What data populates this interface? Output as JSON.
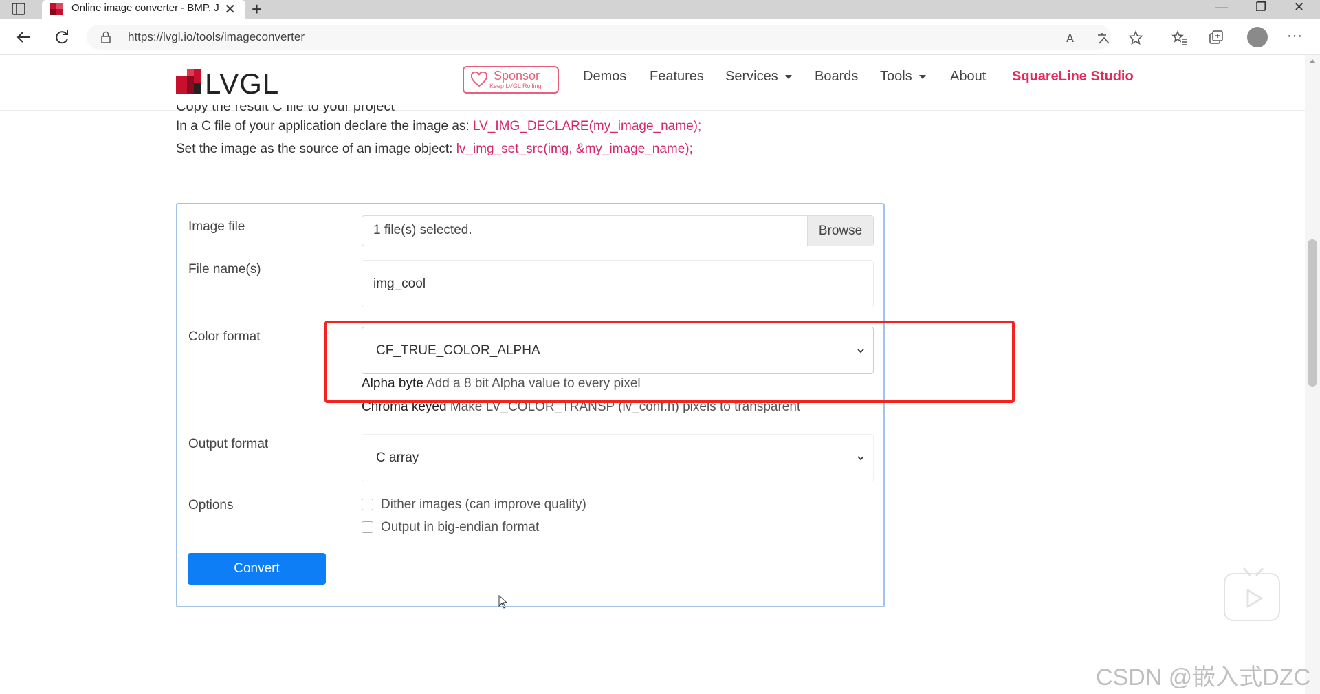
{
  "browser": {
    "tab_title": "Online image converter - BMP, JPG or PNG to C array",
    "url": "https://lvgl.io/tools/imageconverter",
    "new_tab_symbol": "+",
    "close_tab_symbol": "✕",
    "window_controls": [
      "—",
      "❐",
      "✕"
    ],
    "more_symbol": "···"
  },
  "site": {
    "logo_text": "LVGL",
    "sponsor": {
      "label": "Sponsor",
      "sublabel": "Keep LVGL Rolling"
    },
    "nav": [
      {
        "label": "Demos",
        "dropdown": false
      },
      {
        "label": "Features",
        "dropdown": false
      },
      {
        "label": "Services",
        "dropdown": true
      },
      {
        "label": "Boards",
        "dropdown": false
      },
      {
        "label": "Tools",
        "dropdown": true
      },
      {
        "label": "About",
        "dropdown": false
      },
      {
        "label": "SquareLine Studio",
        "dropdown": false
      }
    ],
    "accent_color": "#e5285a"
  },
  "instructions": {
    "partial_line": "Copy the result C file to your project",
    "line1_prefix": "In a C file of your application declare the image as: ",
    "line1_code": "LV_IMG_DECLARE(my_image_name);",
    "line2_prefix": "Set the image as the source of an image object: ",
    "line2_code": "lv_img_set_src(img, &my_image_name);"
  },
  "form": {
    "image_file_label": "Image file",
    "image_file_value": "1 file(s) selected.",
    "browse_label": "Browse",
    "file_name_label": "File name(s)",
    "file_name_value": "img_cool",
    "color_format_label": "Color format",
    "color_format_value": "CF_TRUE_COLOR_ALPHA",
    "hint1_bold": "Alpha byte",
    "hint1_text": " Add a 8 bit Alpha value to every pixel",
    "hint2_bold": "Chroma keyed",
    "hint2_text": " Make LV_COLOR_TRANSP (lv_conf.h) pixels to transparent",
    "output_format_label": "Output format",
    "output_format_value": "C array",
    "options_label": "Options",
    "option1": "Dither images (can improve quality)",
    "option2": "Output in big-endian format",
    "convert_label": "Convert",
    "button_color": "#0d7ef5"
  },
  "overlay": {
    "watermark": "CSDN @嵌入式DZC",
    "highlight_color": "#f4231f"
  }
}
